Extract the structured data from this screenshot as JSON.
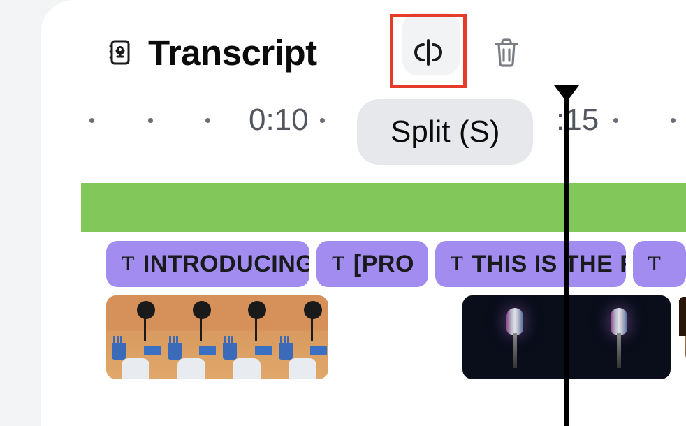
{
  "header": {
    "title": "Transcript",
    "tooltip": "Split (S)"
  },
  "ruler": {
    "labels": [
      "0:10",
      ":15"
    ]
  },
  "text_clips": [
    {
      "label": "INTRODUCING"
    },
    {
      "label": "[PRO"
    },
    {
      "label": "THIS IS THE F"
    },
    {
      "label": ""
    }
  ],
  "colors": {
    "green_track": "#82c75a",
    "text_clip": "#a38cf0",
    "highlight": "#e63a2a"
  }
}
